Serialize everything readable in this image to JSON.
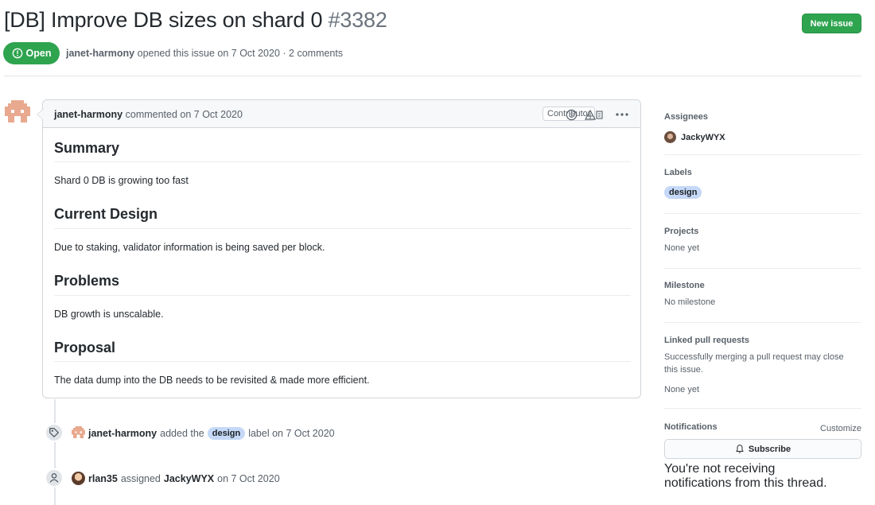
{
  "issue": {
    "title": "[DB] Improve DB sizes on shard 0",
    "number": "#3382",
    "state": "Open",
    "author": "janet-harmony",
    "meta_rest": "opened this issue on 7 Oct 2020 · 2 comments",
    "new_issue_label": "New issue"
  },
  "comment": {
    "author": "janet-harmony",
    "action": "commented on 7 Oct 2020",
    "role": "Contributor",
    "sections": [
      {
        "heading": "Summary",
        "text": "Shard 0 DB is growing too fast"
      },
      {
        "heading": "Current Design",
        "text": "Due to staking, validator information is being saved per block."
      },
      {
        "heading": "Problems",
        "text": "DB growth is unscalable."
      },
      {
        "heading": "Proposal",
        "text": "The data dump into the DB needs to be revisited & made more efficient."
      }
    ]
  },
  "timeline": [
    {
      "actor": "janet-harmony",
      "pre": "added the",
      "label": "design",
      "post": "label on 7 Oct 2020"
    },
    {
      "actor": "rlan35",
      "pre": "assigned",
      "target": "JackyWYX",
      "post": "on 7 Oct 2020"
    }
  ],
  "sidebar": {
    "assignees": {
      "heading": "Assignees",
      "value": "JackyWYX"
    },
    "labels": {
      "heading": "Labels",
      "value": "design"
    },
    "projects": {
      "heading": "Projects",
      "value": "None yet"
    },
    "milestone": {
      "heading": "Milestone",
      "value": "No milestone"
    },
    "linked": {
      "heading": "Linked pull requests",
      "desc": "Successfully merging a pull request may close this issue.",
      "value": "None yet"
    },
    "notifications": {
      "heading": "Notifications",
      "customize": "Customize",
      "subscribe": "Subscribe",
      "desc": "You're not receiving notifications from this thread."
    }
  },
  "colors": {
    "open_green": "#2ea44f",
    "label_design": "#c5d8f7",
    "avatar_pixel": "#e8a98f"
  }
}
